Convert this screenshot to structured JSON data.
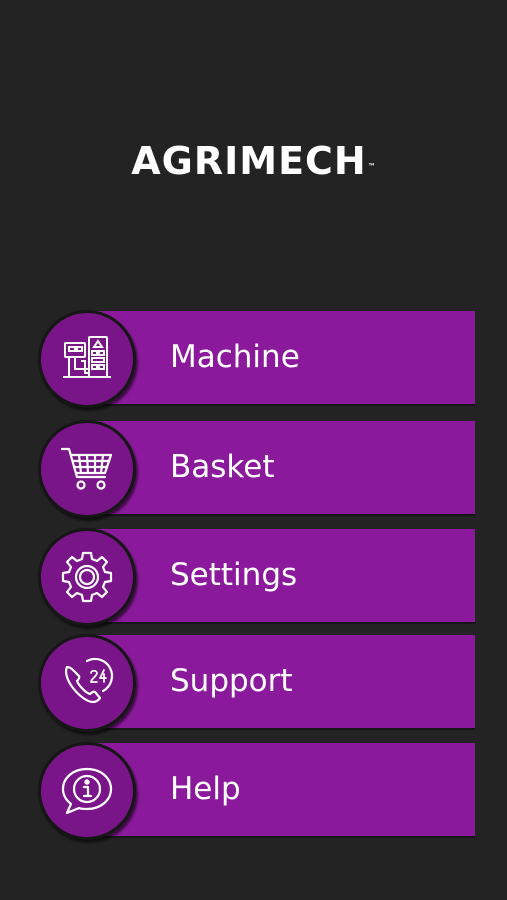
{
  "app": {
    "logo_text": "AGRIMECH",
    "logo_mark": "™"
  },
  "colors": {
    "background": "#232323",
    "button": "#8a1a9b",
    "button_circle": "#7a1589",
    "text": "#ffffff"
  },
  "menu": {
    "items": [
      {
        "label": "Machine",
        "icon": "machine-icon"
      },
      {
        "label": "Basket",
        "icon": "cart-icon"
      },
      {
        "label": "Settings",
        "icon": "gear-icon"
      },
      {
        "label": "Support",
        "icon": "phone-24-icon"
      },
      {
        "label": "Help",
        "icon": "info-bubble-icon"
      }
    ]
  }
}
